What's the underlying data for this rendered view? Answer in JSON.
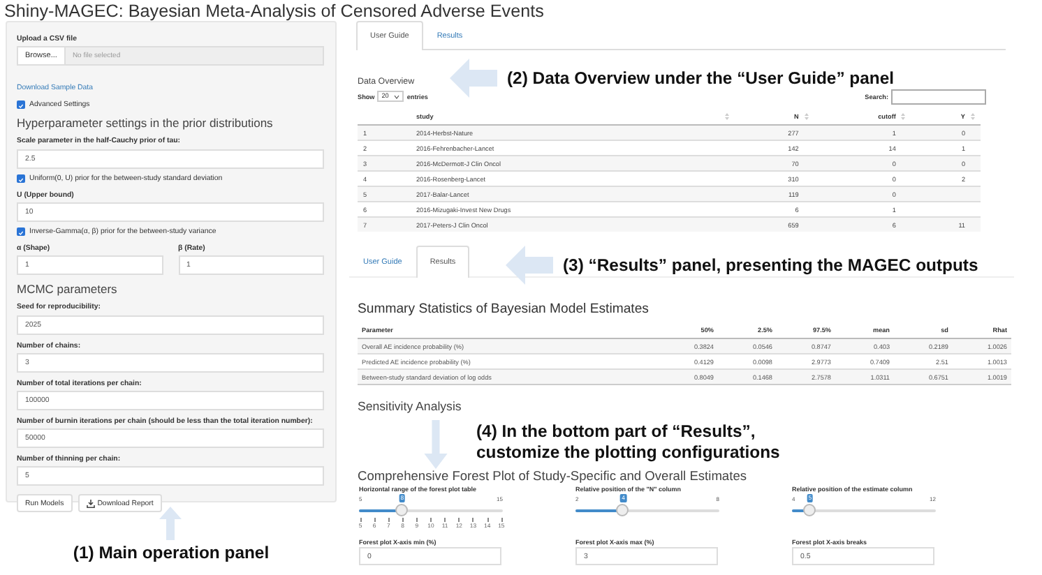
{
  "app_title": "Shiny-MAGEC: Bayesian Meta-Analysis of Censored Adverse Events",
  "sidebar": {
    "items": [
      {
        "kind": "file",
        "label": "Upload a CSV file",
        "button": "Browse...",
        "placeholder": "No file selected"
      },
      {
        "kind": "link",
        "text": "Download Sample Data"
      },
      {
        "kind": "checkbox",
        "label": "Advanced Settings",
        "checked": true
      },
      {
        "kind": "heading",
        "text": "Hyperparameter settings in the prior distributions"
      },
      {
        "kind": "field",
        "label": "Scale parameter in the half-Cauchy prior of tau:",
        "value": "2.5"
      },
      {
        "kind": "checkbox",
        "label": "Uniform(0, U) prior for the between-study standard deviation",
        "checked": true
      },
      {
        "kind": "field",
        "label": "U (Upper bound)",
        "value": "10"
      },
      {
        "kind": "checkbox",
        "label": "Inverse-Gamma(α, β) prior for the between-study variance",
        "checked": true
      },
      {
        "kind": "pair",
        "fields": [
          {
            "label": "α (Shape)",
            "value": "1"
          },
          {
            "label": "β (Rate)",
            "value": "1"
          }
        ]
      },
      {
        "kind": "heading",
        "text": "MCMC parameters"
      },
      {
        "kind": "field",
        "label": "Seed for reproducibility:",
        "value": "2025"
      },
      {
        "kind": "field",
        "label": "Number of chains:",
        "value": "3"
      },
      {
        "kind": "field",
        "label": "Number of total iterations per chain:",
        "value": "100000"
      },
      {
        "kind": "field",
        "label": "Number of burnin iterations per chain (should be less than the total iteration number):",
        "value": "50000"
      },
      {
        "kind": "field",
        "label": "Number of thinning per chain:",
        "value": "5"
      },
      {
        "kind": "buttons",
        "buttons": [
          {
            "label": "Run Models",
            "kind": "plain"
          },
          {
            "label": "Download Report",
            "kind": "download"
          }
        ]
      }
    ]
  },
  "user_guide_view": {
    "tabs": [
      {
        "label": "User Guide",
        "selected": true
      },
      {
        "label": "Results",
        "selected": false
      }
    ],
    "title": "Data Overview",
    "show_label": "Show",
    "page_size": "20",
    "entries_label": "entries",
    "search_label": "Search:",
    "columns": [
      "study",
      "N",
      "cutoff",
      "Y"
    ],
    "rows": [
      {
        "index": "1",
        "cells": [
          "2014-Herbst-Nature",
          "277",
          "1",
          "0"
        ]
      },
      {
        "index": "2",
        "cells": [
          "2016-Fehrenbacher-Lancet",
          "142",
          "14",
          "1"
        ]
      },
      {
        "index": "3",
        "cells": [
          "2016-McDermott-J Clin Oncol",
          "70",
          "0",
          "0"
        ]
      },
      {
        "index": "4",
        "cells": [
          "2016-Rosenberg-Lancet",
          "310",
          "0",
          "2"
        ]
      },
      {
        "index": "5",
        "cells": [
          "2017-Balar-Lancet",
          "119",
          "0"
        ]
      },
      {
        "index": "6",
        "cells": [
          "2016-Mizugaki-Invest New Drugs",
          "6",
          "1"
        ]
      },
      {
        "index": "7",
        "cells": [
          "2017-Peters-J Clin Oncol",
          "659",
          "6",
          "11"
        ]
      }
    ]
  },
  "results_view": {
    "tabs": [
      {
        "label": "User Guide",
        "selected": false
      },
      {
        "label": "Results",
        "selected": true
      }
    ],
    "summary": {
      "title": "Summary Statistics of Bayesian Model Estimates",
      "columns": [
        "Parameter",
        "50%",
        "2.5%",
        "97.5%",
        "mean",
        "sd",
        "Rhat"
      ],
      "rows": [
        [
          "Overall AE incidence probability (%)",
          "0.3824",
          "0.0546",
          "0.8747",
          "0.403",
          "0.2189",
          "1.0026"
        ],
        [
          "Predicted AE incidence probability (%)",
          "0.4129",
          "0.0098",
          "2.9773",
          "0.7409",
          "2.51",
          "1.0013"
        ],
        [
          "Between-study standard deviation of log odds",
          "0.8049",
          "0.1468",
          "2.7578",
          "1.0311",
          "0.6751",
          "1.0019"
        ]
      ]
    },
    "sensitivity_title": "Sensitivity Analysis",
    "forest": {
      "title": "Comprehensive Forest Plot of Study-Specific and Overall Estimates",
      "sliders": [
        {
          "label": "Horizontal range of the forest plot table",
          "min": "5",
          "max": "15",
          "value": "8",
          "level": 0.3,
          "ticks": [
            "5",
            "6",
            "7",
            "8",
            "9",
            "10",
            "11",
            "12",
            "13",
            "14",
            "15"
          ]
        },
        {
          "label": "Relative position of the \"N\" column",
          "min": "2",
          "max": "8",
          "value": "4",
          "level": 0.333
        },
        {
          "label": "Relative position of the estimate column",
          "min": "4",
          "max": "12",
          "value": "5",
          "level": 0.125
        }
      ],
      "fields": [
        {
          "label": "Forest plot X-axis min (%)",
          "value": "0"
        },
        {
          "label": "Forest plot X-axis max (%)",
          "value": "3"
        },
        {
          "label": "Forest plot X-axis breaks",
          "value": "0.5"
        }
      ]
    }
  },
  "annotations": [
    {
      "kind": "up",
      "text": "(1) Main operation panel"
    },
    {
      "kind": "left",
      "text": "(2) Data Overview under the “User Guide” panel"
    },
    {
      "kind": "left",
      "text": "(3) “Results” panel, presenting the MAGEC outputs"
    },
    {
      "kind": "down",
      "lines": [
        "(4) In the bottom part of “Results”,",
        "customize the plotting configurations"
      ]
    }
  ]
}
